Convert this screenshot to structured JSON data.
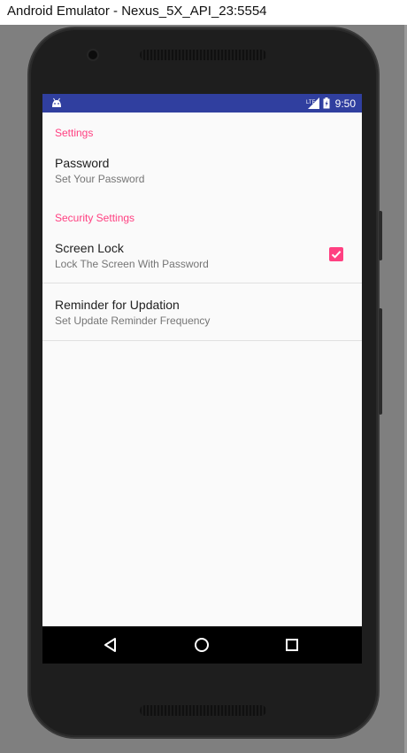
{
  "window": {
    "title": "Android Emulator - Nexus_5X_API_23:5554"
  },
  "status_bar": {
    "time": "9:50",
    "icons": [
      "android-debug-icon",
      "signal-lte-icon",
      "battery-charging-icon"
    ]
  },
  "preferences": {
    "categories": [
      {
        "title": "Settings",
        "items": [
          {
            "title": "Password",
            "summary": "Set Your Password",
            "widget": "none"
          }
        ]
      },
      {
        "title": "Security Settings",
        "items": [
          {
            "title": "Screen Lock",
            "summary": "Lock The Screen With Password",
            "widget": "checkbox",
            "checked": true
          },
          {
            "title": "Reminder for Updation",
            "summary": "Set Update Reminder Frequency",
            "widget": "none"
          }
        ]
      }
    ]
  },
  "nav_bar": {
    "buttons": [
      "back-icon",
      "home-icon",
      "recents-icon"
    ]
  },
  "colors": {
    "status_bar": "#303f9f",
    "accent": "#ff4081",
    "background": "#fafafa",
    "emulator_backdrop": "#7f7f7f"
  }
}
